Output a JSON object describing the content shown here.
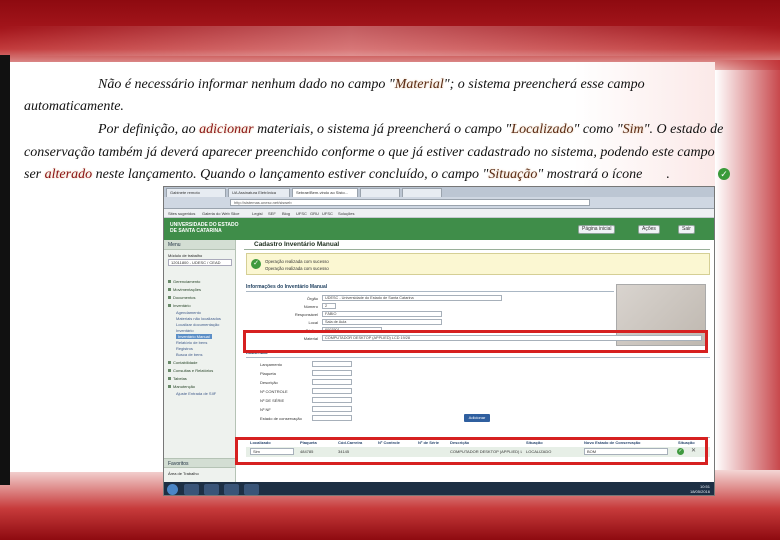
{
  "paragraph": {
    "line1_a": "Não é necessário informar nenhum dado no campo \"",
    "line1_b": "Material",
    "line1_c": "\"; o sistema preencherá esse campo",
    "line2": "automaticamente.",
    "line3_a": "Por definição, ao ",
    "line3_b": "adicionar",
    "line3_c": " materiais, o sistema já preencherá o campo \"",
    "line3_d": "Localizado",
    "line3_e": "\" como \"",
    "line3_f": "Sim",
    "line3_g": "\". O estado de",
    "line4": "conservação também já deverá aparecer preenchido conforme o que já estiver cadastrado no sistema, podendo este campo",
    "line5_a": "ser ",
    "line5_b": "alterado",
    "line5_c": " neste lançamento. Quando o lançamento estiver concluído, o campo \"",
    "line5_d": "Situação",
    "line5_e": "\" mostrará o ícone",
    "line5_f": ".",
    "icon": "check-circle-icon"
  },
  "browser": {
    "tabs": [
      "Gabinete remoto",
      "UA Assinatura Eletrônica",
      "Sebrae/Bem-vindo ao Sisto...",
      "",
      ""
    ],
    "address": "http://sistemas.unesc.net/sisweb",
    "bookmarks": [
      "Sites sugeridos",
      "Galeria do Web Slice",
      "Legisl",
      "SEF",
      "Blog",
      "UFSC",
      "GRU",
      "UFSC",
      "Soluções"
    ]
  },
  "app": {
    "logo_line1": "UNIVERSIDADE DO ESTADO",
    "logo_line2": "DE SANTA CATARINA",
    "header_buttons": [
      "Página inicial",
      "Ações",
      "Sair"
    ],
    "sidebar": {
      "head": "Menu",
      "unit_label": "Módulo de trabalho",
      "unit_value": "12011800 - UDESC / CEAD",
      "items": [
        "Gerenciamento",
        "Movimentações",
        "Documentos",
        "Inventário",
        "Contabilidade",
        "Consultas e Relatórios",
        "Tabelas",
        "Manutenção"
      ],
      "subitems": [
        "Agendamento",
        "Materiais não localizados",
        "Localizar documentação",
        "Inventário",
        "Inventário Manual",
        "Relatório de bens",
        "Registros",
        "Busca de bens"
      ],
      "footer_item": "Ajuste Entrada de SIIF",
      "bottom_head": "Favoritos",
      "bottom_label": "Área de Trabalho"
    },
    "main": {
      "title": "Cadastro Inventário Manual",
      "success_line1": "Operação realizada com sucesso",
      "success_line2": "Operação realizada com sucesso",
      "section_info": "Informações do Inventário Manual",
      "fields": [
        {
          "label": "Órgão",
          "value": "UDESC - Universidade do Estado de Santa Catarina"
        },
        {
          "label": "Número",
          "value": "2"
        },
        {
          "label": "Responsável",
          "value": "FÁBIO"
        },
        {
          "label": "Local",
          "value": "Sala de Aula"
        },
        {
          "label": "Código",
          "value": "6003501"
        },
        {
          "label": "Material",
          "value": "COMPUTADOR DESKTOP (APPLIED) LCD 19/28"
        }
      ],
      "section_materials": "Materiais",
      "material_fields": [
        "Lançamento",
        "Plaqueta",
        "Descrição",
        "Nº CONTROLE",
        "Nº DE SÉRIE",
        "Nº NF",
        "Estado de conservação"
      ],
      "add_label": "Adicionar",
      "table_headers": [
        "Localizado",
        "Plaqueta",
        "Cód.Carreira",
        "Nº Controle",
        "Nº de Série",
        "Descrição",
        "Situação",
        "Novo Estado de Conservação",
        "Situação"
      ],
      "row": [
        "Sim",
        "484785",
        "34145",
        "",
        "",
        "COMPUTADOR DESKTOP (APPLIED) LCD 19",
        "LOCALIZADO",
        "BOM",
        ""
      ]
    },
    "taskbar_time": "10:51",
    "taskbar_date": "18/05/2016"
  }
}
